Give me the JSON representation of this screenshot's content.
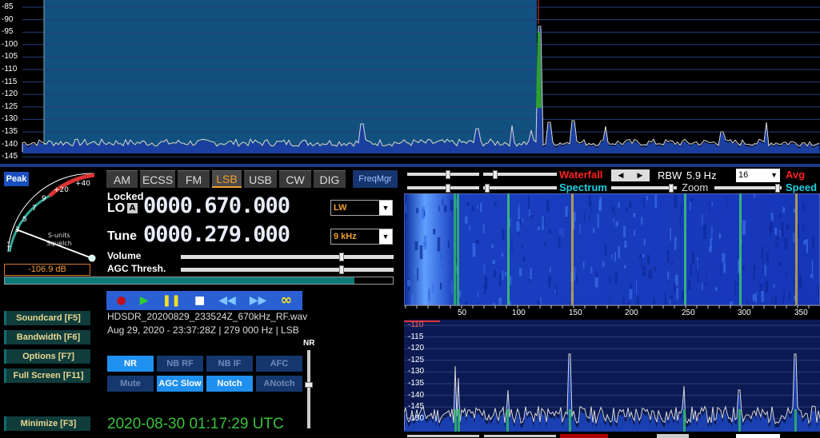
{
  "top_spectrum": {
    "y_labels": [
      "-85",
      "-90",
      "-95",
      "-100",
      "-105",
      "-110",
      "-115",
      "-120",
      "-125",
      "-130",
      "-135",
      "-140",
      "-145"
    ]
  },
  "smeter": {
    "peak_label": "Peak",
    "scale_labels": [
      "1",
      "3",
      "5",
      "7",
      "9",
      "+20",
      "+40"
    ],
    "s_units_label": "S-units",
    "squelch_label": "Squelch",
    "readout": "-106.9 dB",
    "level_fraction": 0.9
  },
  "modes": {
    "items": [
      {
        "label": "AM",
        "active": false
      },
      {
        "label": "ECSS",
        "active": false
      },
      {
        "label": "FM",
        "active": false
      },
      {
        "label": "LSB",
        "active": true
      },
      {
        "label": "USB",
        "active": false
      },
      {
        "label": "CW",
        "active": false
      },
      {
        "label": "DIG",
        "active": false
      }
    ],
    "freqmgr": "FreqMgr"
  },
  "lo": {
    "locked_label": "Locked",
    "label": "LO",
    "a_badge": "A",
    "frequency": "0000.670.000",
    "band_select": "LW"
  },
  "tune": {
    "label": "Tune",
    "frequency": "0000.279.000",
    "bandwidth_select": "9 kHz"
  },
  "sliders": {
    "volume_label": "Volume",
    "agc_label": "AGC Thresh."
  },
  "transport": {
    "record_icon": "record-icon",
    "play_icon": "play-icon",
    "pause_icon": "pause-icon",
    "stop_icon": "stop-icon",
    "rewind_icon": "rewind-icon",
    "forward_icon": "forward-icon",
    "loop_icon": "loop-icon"
  },
  "file": {
    "name": "HDSDR_20200829_233524Z_670kHz_RF.wav",
    "info": "Aug 29, 2020 - 23:37:28Z | 279 000 Hz | LSB"
  },
  "left_buttons": {
    "soundcard": "Soundcard  [F5]",
    "bandwidth": "Bandwidth  [F6]",
    "options": "Options  [F7]",
    "fullscreen": "Full Screen  [F11]",
    "minimize": "Minimize  [F3]"
  },
  "dsp": {
    "nr": "NR",
    "nb_rf": "NB RF",
    "nb_if": "NB IF",
    "afc": "AFC",
    "mute": "Mute",
    "agc_slow": "AGC Slow",
    "notch": "Notch",
    "anotch": "ANotch",
    "nr_slider_label": "NR"
  },
  "clock": "2020-08-30   01:17:29 UTC",
  "right_panel": {
    "waterfall_label": "Waterfall",
    "rbw_label": "RBW",
    "rbw_value": "5.9 Hz",
    "avg_select": "16",
    "avg_label": "Avg",
    "spectrum_label": "Spectrum",
    "zoom_label": "Zoom",
    "speed_label": "Speed",
    "axis_labels": [
      "50",
      "100",
      "150",
      "200",
      "250",
      "300",
      "350"
    ],
    "lower_y_labels": [
      "-110",
      "-115",
      "-120",
      "-125",
      "-130",
      "-135",
      "-140",
      "-145",
      "-150"
    ]
  },
  "colors": {
    "accent_orange": "#f0a030",
    "waterfall_red": "#ff2020",
    "spectrum_cyan": "#20d0e0",
    "clock_green": "#39c23c",
    "dsp_on": "#2090f0"
  }
}
